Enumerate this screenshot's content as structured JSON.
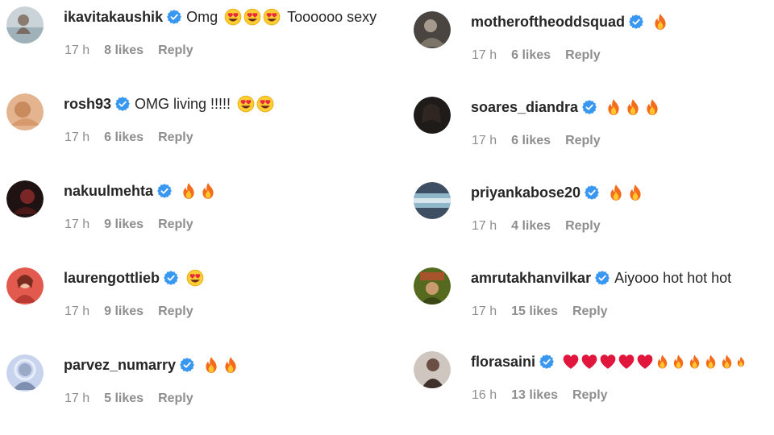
{
  "left_comments": [
    {
      "username": "ikavitakaushik",
      "text": "Omg",
      "emojis_before": [
        "heart-eyes",
        "heart-eyes",
        "heart-eyes"
      ],
      "text_after": "Toooooo sexy",
      "time": "17 h",
      "likes": "8 likes",
      "reply": "Reply",
      "avatar_color": "#b9c7cf"
    },
    {
      "username": "rosh93",
      "text": "OMG living !!!!!",
      "emojis": [
        "heart-eyes",
        "heart-eyes"
      ],
      "time": "17 h",
      "likes": "6 likes",
      "reply": "Reply",
      "avatar_color": "#d8a27b"
    },
    {
      "username": "nakuulmehta",
      "text": "",
      "emojis": [
        "fire",
        "fire"
      ],
      "time": "17 h",
      "likes": "9 likes",
      "reply": "Reply",
      "avatar_color": "#3a1a1a"
    },
    {
      "username": "laurengottlieb",
      "text": "",
      "emojis": [
        "heart-eyes"
      ],
      "time": "17 h",
      "likes": "9 likes",
      "reply": "Reply",
      "avatar_color": "#e0534a"
    },
    {
      "username": "parvez_numarry",
      "text": "",
      "emojis": [
        "fire",
        "fire"
      ],
      "time": "17 h",
      "likes": "5 likes",
      "reply": "Reply",
      "avatar_color": "#b7c6e6"
    }
  ],
  "right_comments": [
    {
      "username": "motheroftheoddsquad",
      "text": "",
      "emojis": [
        "fire"
      ],
      "time": "17 h",
      "likes": "6 likes",
      "reply": "Reply",
      "avatar_color": "#6f6a62"
    },
    {
      "username": "soares_diandra",
      "text": "",
      "emojis": [
        "fire",
        "fire",
        "fire"
      ],
      "time": "17 h",
      "likes": "6 likes",
      "reply": "Reply",
      "avatar_color": "#2a2624"
    },
    {
      "username": "priyankabose20",
      "text": "",
      "emojis": [
        "fire",
        "fire"
      ],
      "time": "17 h",
      "likes": "4 likes",
      "reply": "Reply",
      "avatar_color": "#4b5e73"
    },
    {
      "username": "amrutakhanvilkar",
      "text": "Aiyooo hot hot hot",
      "emojis": [],
      "time": "17 h",
      "likes": "15 likes",
      "reply": "Reply",
      "avatar_color": "#6b7a2a"
    },
    {
      "username": "florasaini",
      "text": "",
      "emojis": [
        "heart",
        "heart",
        "heart",
        "heart",
        "heart",
        "fire",
        "fire",
        "fire",
        "fire",
        "fire",
        "fire"
      ],
      "time": "16 h",
      "likes": "13 likes",
      "reply": "Reply",
      "avatar_color": "#5b4a45"
    }
  ],
  "colors": {
    "verified": "#3897f0",
    "meta": "#8e8e8e",
    "username": "#262626"
  }
}
